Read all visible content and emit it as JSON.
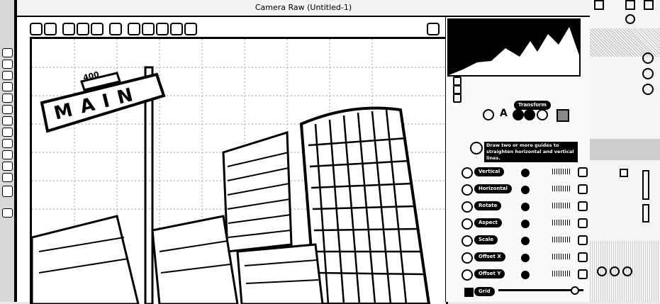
{
  "window": {
    "title": "Camera Raw (Untitled-1)"
  },
  "toolbar": {
    "tools": [
      "zoom-icon",
      "hand-icon",
      "white-balance-icon",
      "color-sampler-icon",
      "targeted-adjustment-icon",
      "crop-icon",
      "transform-icon",
      "spot-removal-icon",
      "red-eye-icon",
      "adjustment-brush-icon",
      "graduated-filter-icon",
      "radial-filter-icon"
    ]
  },
  "image": {
    "sign_number": "400",
    "sign_street": "MAIN"
  },
  "panel": {
    "section_title": "Transform",
    "instruction": "Draw two or more guides to straighten horizontal and vertical lines.",
    "sliders": [
      {
        "label": "Vertical"
      },
      {
        "label": "Horizontal"
      },
      {
        "label": "Rotate"
      },
      {
        "label": "Aspect"
      },
      {
        "label": "Scale"
      },
      {
        "label": "Offset X"
      },
      {
        "label": "Offset Y"
      }
    ],
    "grid_label": "Grid",
    "grid_checked": true
  }
}
